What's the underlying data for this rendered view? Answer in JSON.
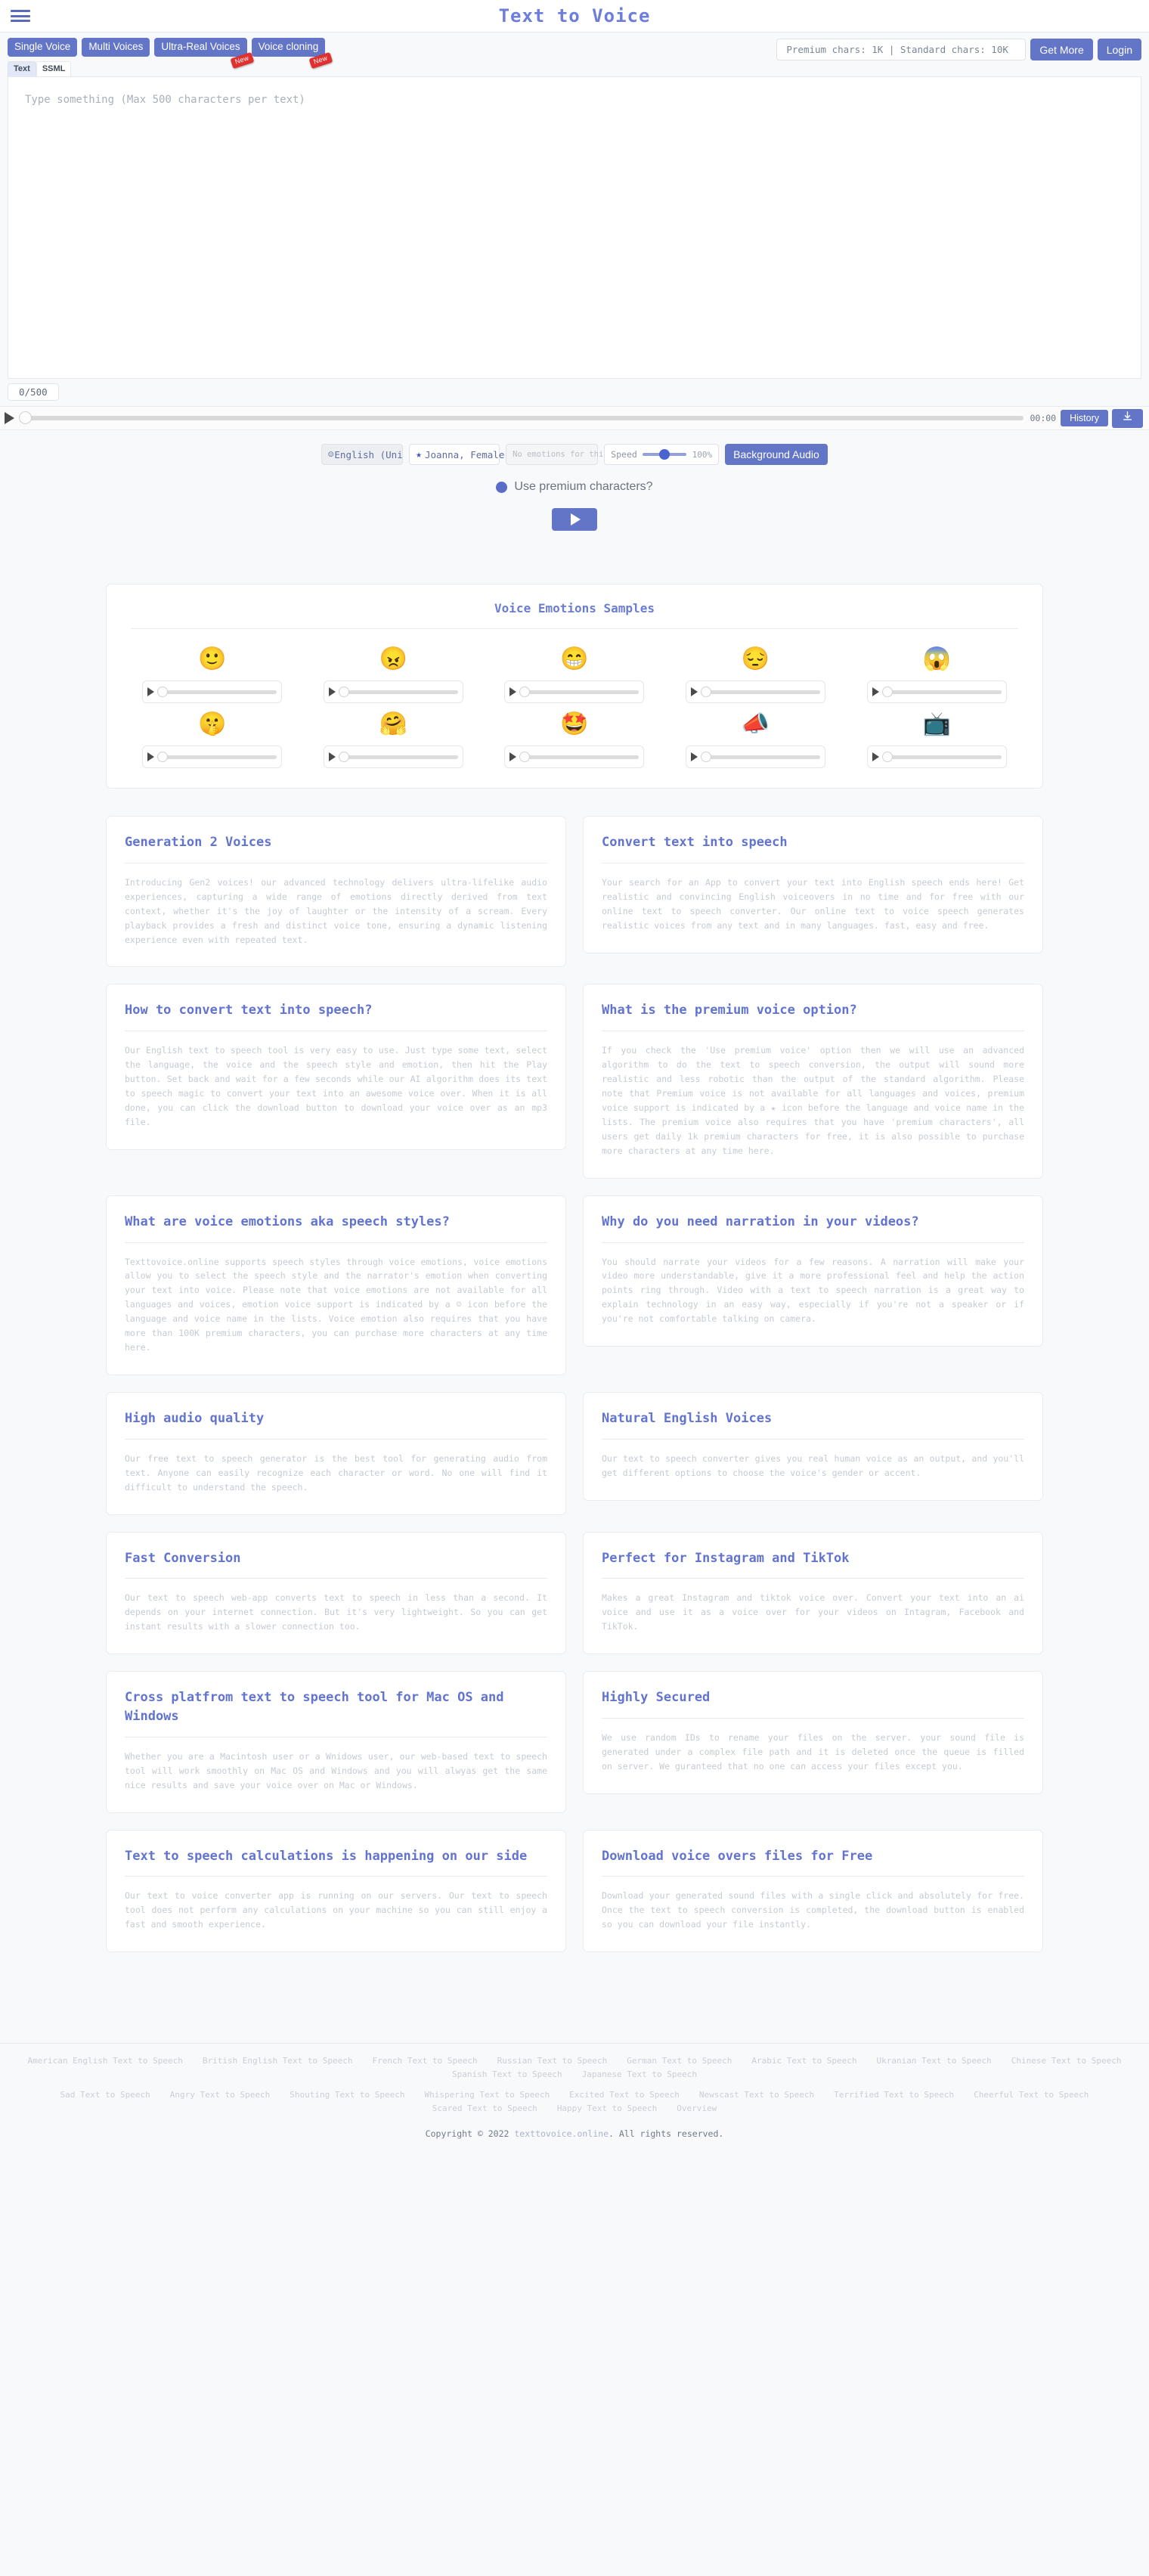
{
  "header": {
    "title": "Text to Voice",
    "menu_icon": "hamburger-icon"
  },
  "toolbar": {
    "modes": [
      {
        "label": "Single Voice",
        "badge": null
      },
      {
        "label": "Multi Voices",
        "badge": null
      },
      {
        "label": "Ultra-Real Voices",
        "badge": "New"
      },
      {
        "label": "Voice cloning",
        "badge": "New"
      }
    ],
    "chars_info": "Premium chars: 1K | Standard chars: 10K",
    "get_more_label": "Get More",
    "login_label": "Login"
  },
  "subtabs": [
    {
      "label": "Text",
      "active": true
    },
    {
      "label": "SSML",
      "active": false
    }
  ],
  "editor": {
    "placeholder": "Type something (Max 500 characters per text)",
    "value": "",
    "counter": "0/500"
  },
  "player": {
    "play_icon": "play-icon",
    "time": "00:00",
    "history_label": "History",
    "download_icon": "download-icon",
    "progress": 0
  },
  "controls": {
    "language": {
      "value": "English (Unit",
      "icon": "smiley-icon"
    },
    "voice": {
      "value": "Joanna, Female",
      "icon": "star-icon"
    },
    "emotion": {
      "value": "No emotions for this voice"
    },
    "speed": {
      "label": "Speed",
      "value": "100%"
    },
    "background_audio_label": "Background Audio",
    "premium_label": "Use premium characters?",
    "generate_icon": "play-icon"
  },
  "emotions": {
    "title": "Voice Emotions Samples",
    "samples": [
      {
        "name": "neutral",
        "emoji": "🙂"
      },
      {
        "name": "angry",
        "emoji": "😠"
      },
      {
        "name": "happy",
        "emoji": "😁"
      },
      {
        "name": "sad",
        "emoji": "😔"
      },
      {
        "name": "terrified",
        "emoji": "😱"
      },
      {
        "name": "whispering",
        "emoji": "🤫"
      },
      {
        "name": "cheerful",
        "emoji": "🤗"
      },
      {
        "name": "excited",
        "emoji": "🤩"
      },
      {
        "name": "shouting",
        "emoji": "📣"
      },
      {
        "name": "newscast",
        "emoji": "📺"
      }
    ]
  },
  "info_cards": [
    {
      "title": "Generation 2 Voices",
      "body": "Introducing Gen2 voices! our advanced technology delivers ultra-lifelike audio experiences, capturing a wide range of emotions directly derived from text context, whether it's the joy of laughter or the intensity of a scream. Every playback provides a fresh and distinct voice tone, ensuring a dynamic listening experience even with repeated text."
    },
    {
      "title": "Convert text into speech",
      "body": "Your search for an App to convert your text into English speech ends here! Get realistic and convincing English voiceovers in no time and for free with our online text to speech converter. Our online text to voice speech generates realistic voices from any text and in many languages. fast, easy and free."
    },
    {
      "title": "How to convert text into speech?",
      "body": "Our English text to speech tool is very easy to use. Just type some text, select the language, the voice and the speech style and emotion, then hit the Play button. Set back and wait for a few seconds while our AI algorithm does its text to speech magic to convert your text into an awesome voice over. When it is all done, you can click the download button to download your voice over as an mp3 file."
    },
    {
      "title": "What is the premium voice option?",
      "body": "If you check the 'Use premium voice' option then we will use an advanced algorithm to do the text to speech conversion, the output will sound more realistic and less robotic than the output of the standard algorithm. Please note that Premium voice is not available for all languages and voices, premium voice support is indicated by a ★ icon before the language and voice name in the lists. The premium voice also requires that you have 'premium characters', all users get daily 1k premium characters for free, it is also possible to purchase more characters at any time here."
    },
    {
      "title": "What are voice emotions aka speech styles?",
      "body": "Texttovoice.online supports speech styles through voice emotions, voice emotions allow you to select the speech style and the narrator's emotion when converting your text into voice. Please note that voice emotions are not available for all languages and voices, emotion voice support is indicated by a ☺ icon before the language and voice name in the lists. Voice emotion also requires that you have more than 100K premium characters, you can purchase more characters at any time here."
    },
    {
      "title": "Why do you need narration in your videos?",
      "body": "You should narrate your videos for a few reasons. A narration will make your video more understandable, give it a more professional feel and help the action points ring through. Video with a text to speech narration is a great way to explain technology in an easy way, especially if you're not a speaker or if you're not comfortable talking on camera."
    },
    {
      "title": "High audio quality",
      "body": "Our free text to speech generator is the best tool for generating audio from text. Anyone can easily recognize each character or word. No one will find it difficult to understand the speech."
    },
    {
      "title": "Natural English Voices",
      "body": "Our text to speech converter gives you real human voice as an output, and you'll get different options to choose the voice's gender or accent."
    },
    {
      "title": "Fast Conversion",
      "body": "Our text to speech web-app converts text to speech in less than a second. It depends on your internet connection. But it's very lightweight. So you can get instant results with a slower connection too."
    },
    {
      "title": "Perfect for Instagram and TikTok",
      "body": "Makes a great Instagram and tiktok voice over. Convert your text into an ai voice and use it as a voice over for your videos on Intagram, Facebook and TikTok."
    },
    {
      "title": "Cross platfrom text to speech tool for Mac OS and Windows",
      "body": "Whether you are a Macintosh user or a Wnidows user, our web-based text to speech tool will work smoothly on Mac OS and Windows and you will alwyas get the same nice results and save your voice over on Mac or Windows."
    },
    {
      "title": "Highly Secured",
      "body": "We use random IDs to rename your files on the server. your sound file is generated under a complex file path and it is deleted once the queue is filled on server. We guranteed that no one can access your files except you."
    },
    {
      "title": "Text to speech calculations is happening on our side",
      "body": "Our text to voice converter app is running on our servers. Our text to speech tool does not perform any calculations on your machine so you can still enjoy a fast and smooth experience."
    },
    {
      "title": "Download voice overs files for Free",
      "body": "Download your generated sound files with a single click and absolutely for free. Once the text to speech conversion is completed, the download button is enabled so you can download your file instantly."
    }
  ],
  "footer": {
    "language_links": [
      "American English Text to Speech",
      "British English Text to Speech",
      "French Text to Speech",
      "Russian Text to Speech",
      "German Text to Speech",
      "Arabic Text to Speech",
      "Ukranian Text to Speech",
      "Chinese Text to Speech",
      "Spanish Text to Speech",
      "Japanese Text to Speech"
    ],
    "emotion_links": [
      "Sad Text to Speech",
      "Angry Text to Speech",
      "Shouting Text to Speech",
      "Whispering Text to Speech",
      "Excited Text to Speech",
      "Newscast Text to Speech",
      "Terrified Text to Speech",
      "Cheerful Text to Speech",
      "Scared Text to Speech",
      "Happy Text to Speech",
      "Overview"
    ],
    "copyright_prefix": "Copyright © 2022 ",
    "copyright_site": "texttovoice.online",
    "copyright_suffix": ". All rights reserved."
  },
  "colors": {
    "accent": "#6375c7",
    "badge": "#e03030",
    "heading": "#6274cf"
  }
}
